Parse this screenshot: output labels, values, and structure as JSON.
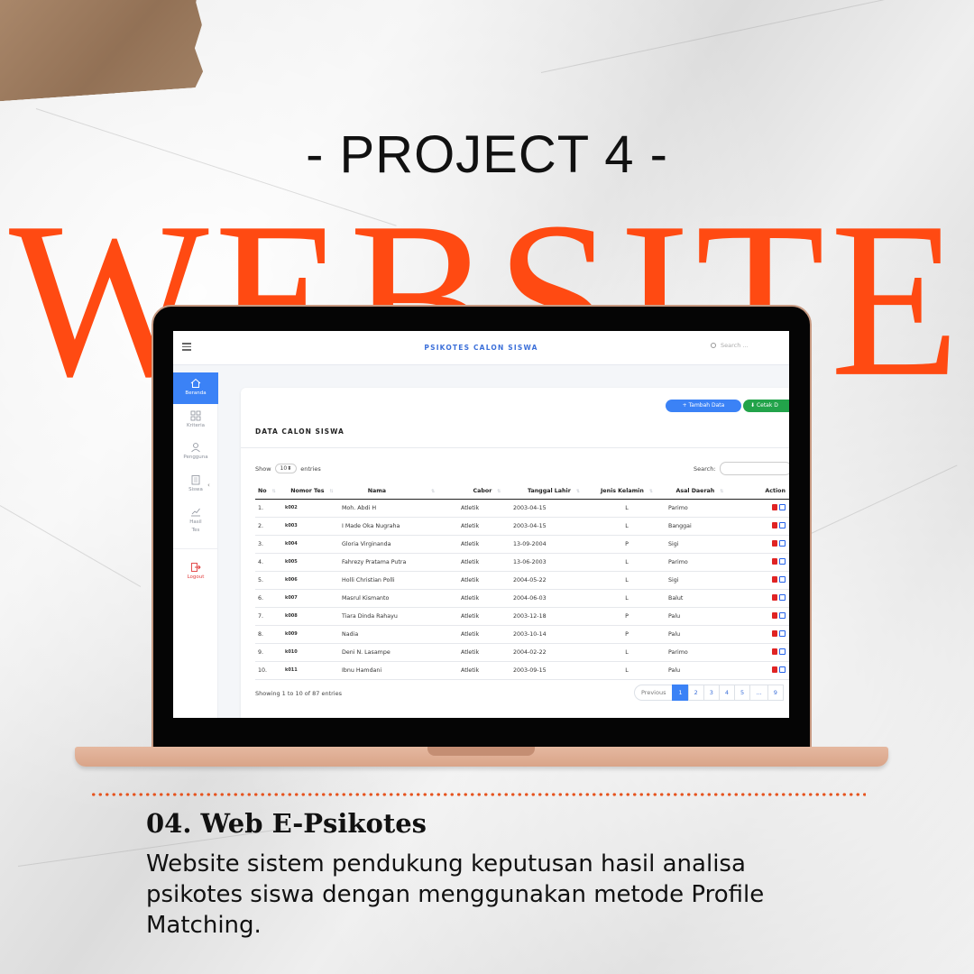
{
  "header": {
    "project_label": "- PROJECT 4 -",
    "category_word": "WEBSITE"
  },
  "app": {
    "title": "PSIKOTES CALON SISWA",
    "search_placeholder": "Search ...",
    "sidebar": {
      "items": [
        {
          "label": "Beranda",
          "icon": "home-icon"
        },
        {
          "label": "Kriteria",
          "icon": "grid-icon"
        },
        {
          "label": "Pengguna",
          "icon": "user-icon"
        },
        {
          "label": "Siswa",
          "icon": "clipboard-icon"
        },
        {
          "label": "Hasil Tes",
          "icon": "chart-icon"
        },
        {
          "label": "Logout",
          "icon": "logout-icon"
        }
      ]
    },
    "card": {
      "add_button": "Tambah Data",
      "print_button": "Cetak D",
      "title": "DATA CALON SISWA",
      "show_label": "Show",
      "entries_value": "10",
      "entries_label": "entries",
      "search_label": "Search:",
      "columns": [
        "No",
        "Nomor Tes",
        "Nama",
        "Cabor",
        "Tanggal Lahir",
        "Jenis Kelamin",
        "Asal Daerah",
        "Action"
      ],
      "rows": [
        [
          "1.",
          "k002",
          "Moh. Abdi H",
          "Atletik",
          "2003-04-15",
          "L",
          "Parimo"
        ],
        [
          "2.",
          "k003",
          "I Made Oka Nugraha",
          "Atletik",
          "2003-04-15",
          "L",
          "Banggai"
        ],
        [
          "3.",
          "k004",
          "Gloria Virginanda",
          "Atletik",
          "13-09-2004",
          "P",
          "Sigi"
        ],
        [
          "4.",
          "k005",
          "Fahrezy Pratama Putra",
          "Atletik",
          "13-06-2003",
          "L",
          "Parimo"
        ],
        [
          "5.",
          "k006",
          "Holli Christian Polli",
          "Atletik",
          "2004-05-22",
          "L",
          "Sigi"
        ],
        [
          "6.",
          "k007",
          "Masrul Kismanto",
          "Atletik",
          "2004-06-03",
          "L",
          "Balut"
        ],
        [
          "7.",
          "k008",
          "Tiara Dinda Rahayu",
          "Atletik",
          "2003-12-18",
          "P",
          "Palu"
        ],
        [
          "8.",
          "k009",
          "Nadia",
          "Atletik",
          "2003-10-14",
          "P",
          "Palu"
        ],
        [
          "9.",
          "k010",
          "Deni N. Lasampe",
          "Atletik",
          "2004-02-22",
          "L",
          "Parimo"
        ],
        [
          "10.",
          "k011",
          "Ibnu Hamdani",
          "Atletik",
          "2003-09-15",
          "L",
          "Palu"
        ]
      ],
      "info": "Showing 1 to 10 of 87 entries",
      "pagination": {
        "previous": "Previous",
        "pages": [
          "1",
          "2",
          "3",
          "4",
          "5",
          "…",
          "9"
        ],
        "current": "1"
      }
    }
  },
  "footer": {
    "heading": "04. Web E-Psikotes",
    "description": "Website sistem pendukung keputusan hasil analisa psikotes siswa dengan menggunakan metode Profile Matching."
  },
  "colors": {
    "accent": "#ff4a12",
    "primary_button": "#3b82f6",
    "print_button": "#22a34a",
    "laptop_base": "#d9a488"
  }
}
